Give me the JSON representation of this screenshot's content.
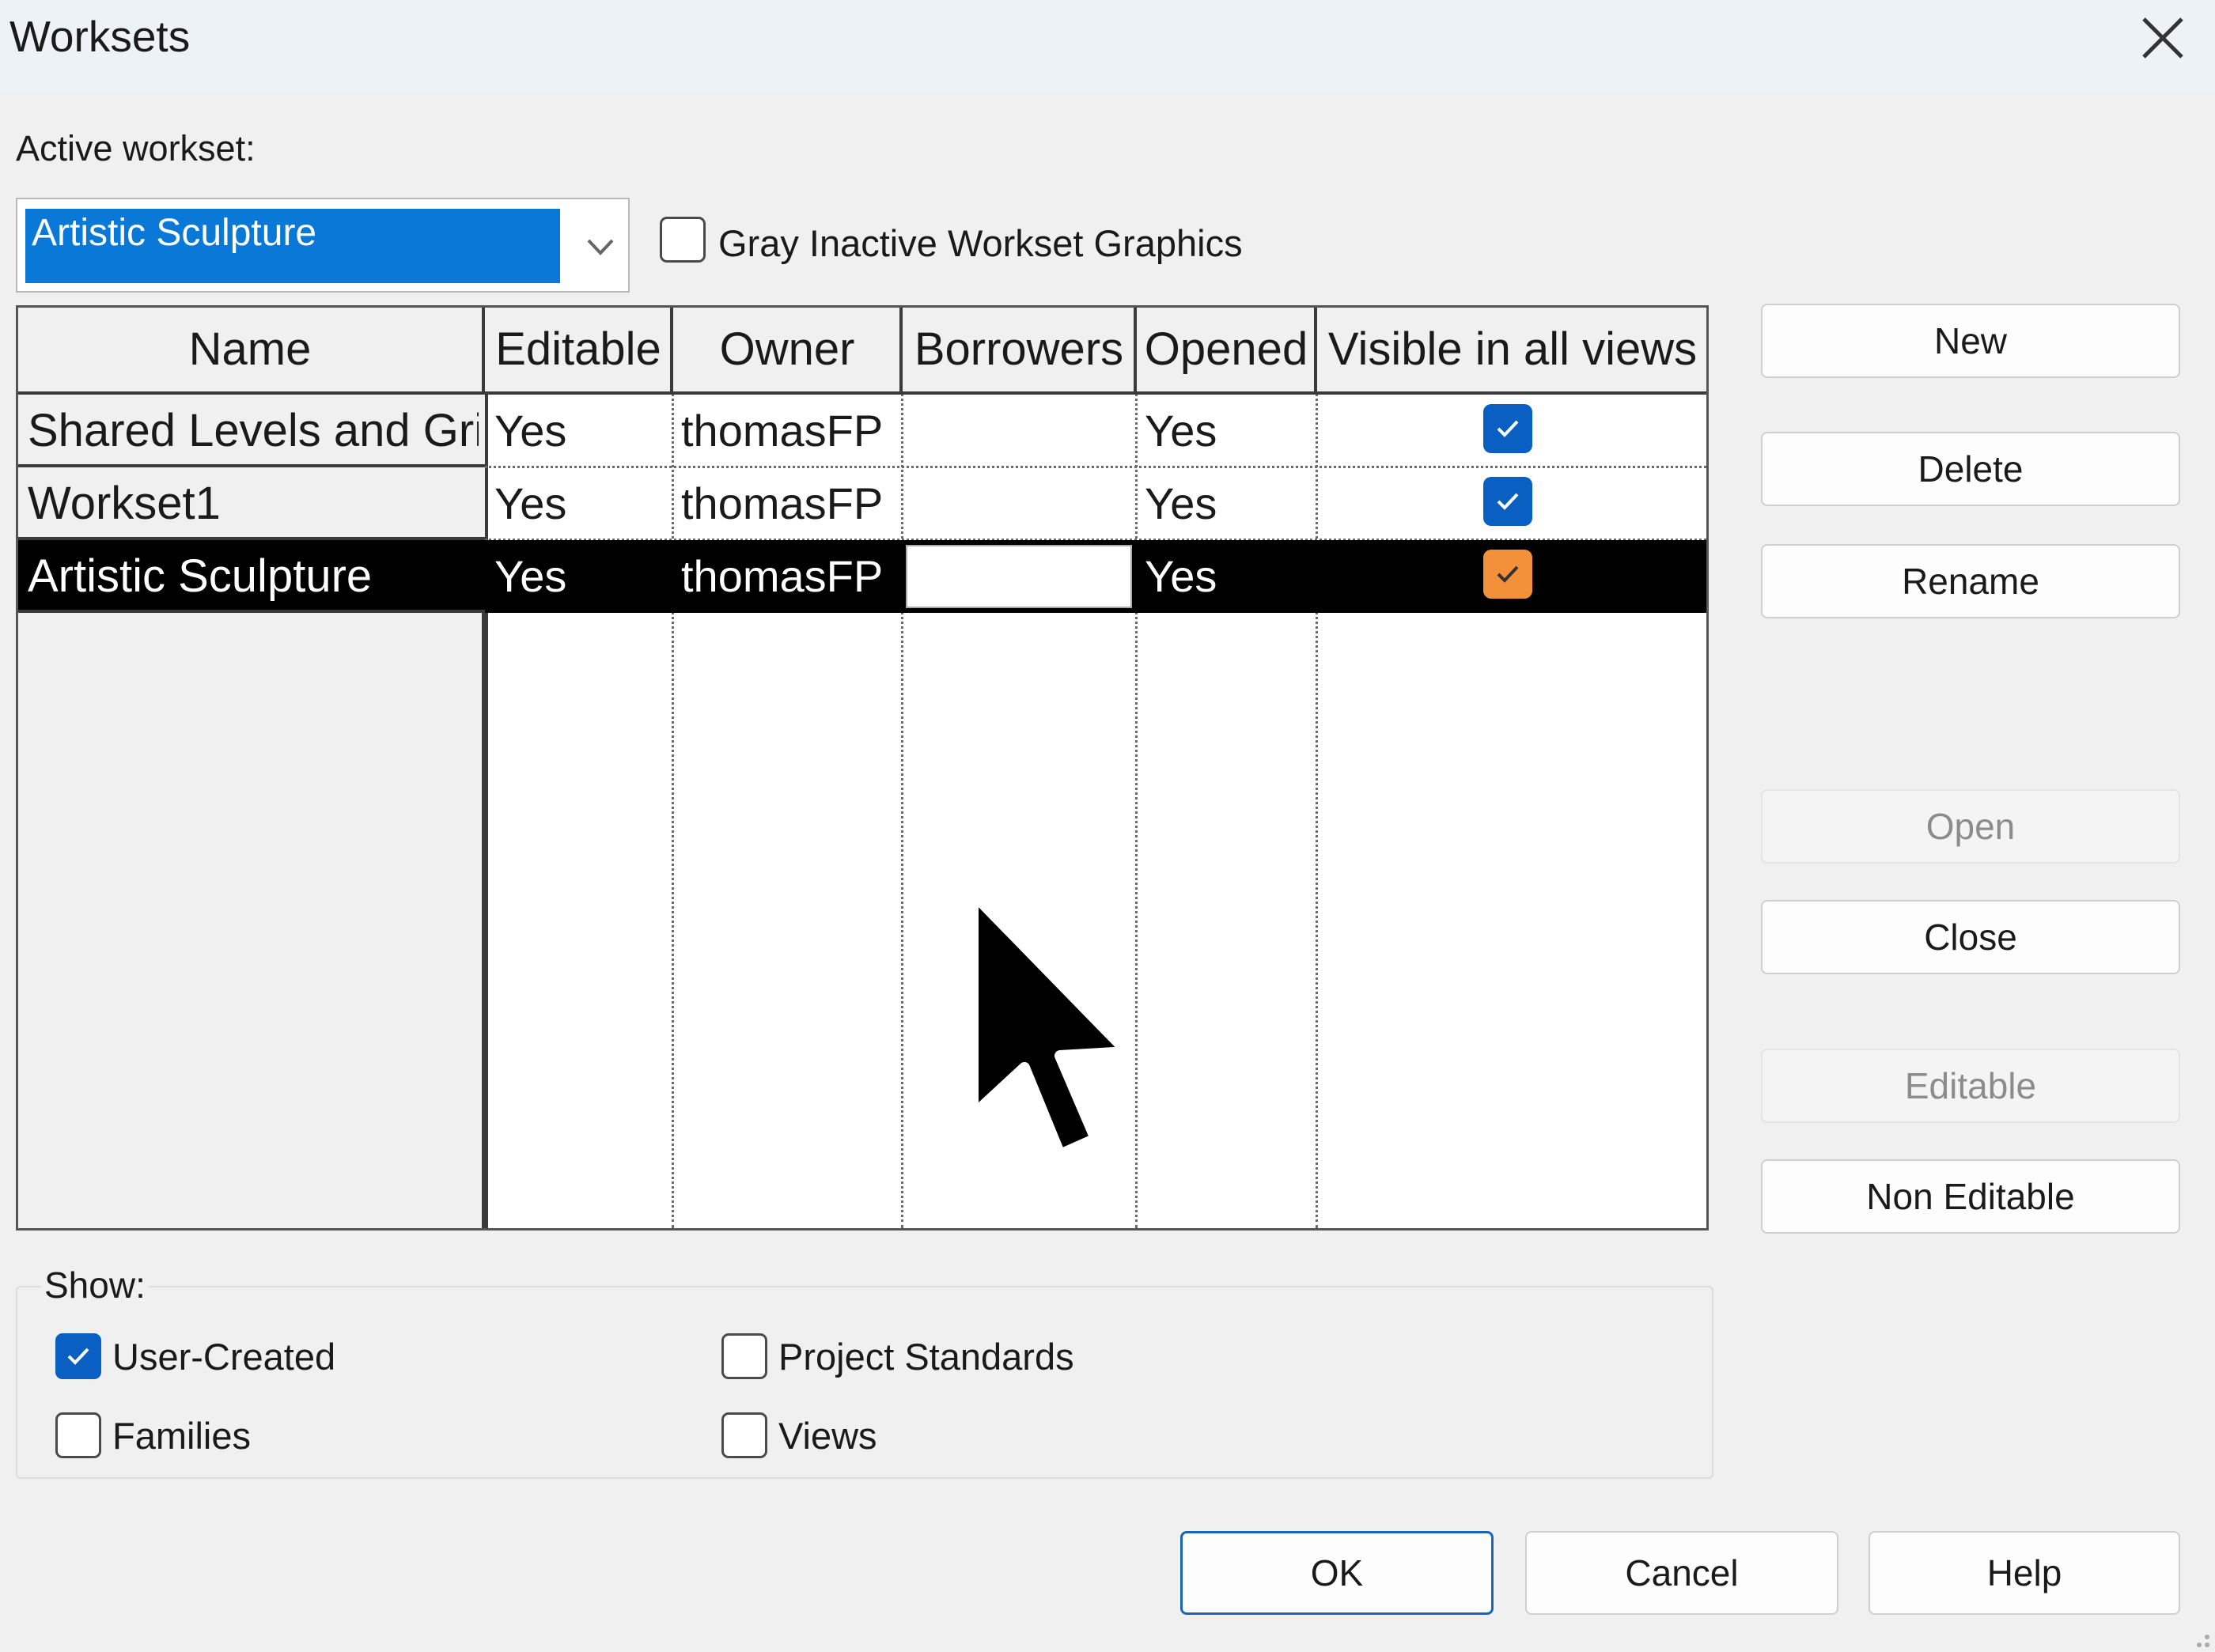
{
  "window": {
    "title": "Worksets",
    "close_icon": "close-icon"
  },
  "active_workset": {
    "label": "Active workset:",
    "selected": "Artistic Sculpture",
    "gray_inactive_label": "Gray Inactive Workset Graphics",
    "gray_inactive_checked": false
  },
  "table": {
    "columns": [
      "Name",
      "Editable",
      "Owner",
      "Borrowers",
      "Opened",
      "Visible in all views"
    ],
    "rows": [
      {
        "name": "Shared Levels and Gri",
        "editable": "Yes",
        "owner": "thomasFP",
        "borrowers": "",
        "opened": "Yes",
        "visible": true
      },
      {
        "name": "Workset1",
        "editable": "Yes",
        "owner": "thomasFP",
        "borrowers": "",
        "opened": "Yes",
        "visible": true
      },
      {
        "name": "Artistic Sculpture",
        "editable": "Yes",
        "owner": "thomasFP",
        "borrowers": "",
        "opened": "Yes",
        "visible": true
      }
    ],
    "selected_row": 2
  },
  "side_buttons": {
    "new": "New",
    "delete": "Delete",
    "rename": "Rename",
    "open": "Open",
    "close": "Close",
    "editable": "Editable",
    "non_editable": "Non Editable"
  },
  "show": {
    "label": "Show:",
    "user_created": {
      "label": "User-Created",
      "checked": true
    },
    "families": {
      "label": "Families",
      "checked": false
    },
    "project_standards": {
      "label": "Project Standards",
      "checked": false
    },
    "views": {
      "label": "Views",
      "checked": false
    }
  },
  "footer": {
    "ok": "OK",
    "cancel": "Cancel",
    "help": "Help"
  },
  "colors": {
    "accent": "#0a78d7",
    "checkbox_blue": "#0a5fc2",
    "checkbox_selected": "#f2913a",
    "selection": "#000000"
  }
}
